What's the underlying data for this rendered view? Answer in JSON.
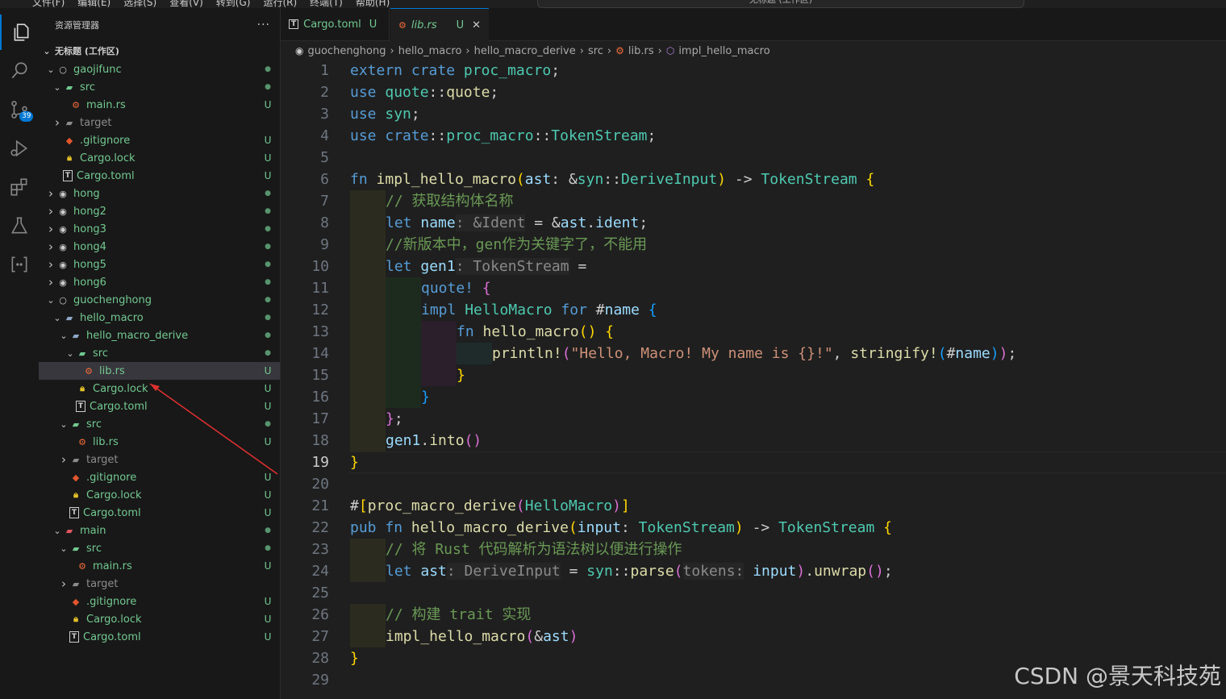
{
  "titlebar": {
    "menu": [
      "文件(F)",
      "编辑(E)",
      "选择(S)",
      "查看(V)",
      "转到(G)",
      "运行(R)",
      "终端(T)",
      "帮助(H)"
    ],
    "command_center": "无标题 (工作区)"
  },
  "activity_bar": {
    "items": [
      "explorer-icon",
      "search-icon",
      "source-control-icon",
      "run-debug-icon",
      "extensions-icon",
      "testing-icon",
      "remote-explorer-icon"
    ],
    "scm_badge": "39"
  },
  "sidebar": {
    "title": "资源管理器",
    "more": "···",
    "workspace_title": "无标题 (工作区)",
    "tree": [
      {
        "depth": 1,
        "chev": "v",
        "icon": "folder-root",
        "label": "gaojifunc",
        "status": "●",
        "color": "green"
      },
      {
        "depth": 2,
        "chev": "v",
        "icon": "folder-src",
        "label": "src",
        "status": "●",
        "color": "green"
      },
      {
        "depth": 3,
        "chev": "",
        "icon": "rust",
        "label": "main.rs",
        "status": "U",
        "color": "green"
      },
      {
        "depth": 2,
        "chev": ">",
        "icon": "folder-target",
        "label": "target",
        "status": "",
        "color": "gray"
      },
      {
        "depth": 2,
        "chev": "",
        "icon": "git",
        "label": ".gitignore",
        "status": "U",
        "color": "green"
      },
      {
        "depth": 2,
        "chev": "",
        "icon": "lock",
        "label": "Cargo.lock",
        "status": "U",
        "color": "green"
      },
      {
        "depth": 2,
        "chev": "",
        "icon": "toml",
        "label": "Cargo.toml",
        "status": "U",
        "color": "green"
      },
      {
        "depth": 1,
        "chev": ">",
        "icon": "folder-root-dot",
        "label": "hong",
        "status": "●",
        "color": "green"
      },
      {
        "depth": 1,
        "chev": ">",
        "icon": "folder-root-dot",
        "label": "hong2",
        "status": "●",
        "color": "green"
      },
      {
        "depth": 1,
        "chev": ">",
        "icon": "folder-root-dot",
        "label": "hong3",
        "status": "●",
        "color": "green"
      },
      {
        "depth": 1,
        "chev": ">",
        "icon": "folder-root-dot",
        "label": "hong4",
        "status": "●",
        "color": "green"
      },
      {
        "depth": 1,
        "chev": ">",
        "icon": "folder-root-dot",
        "label": "hong5",
        "status": "●",
        "color": "green"
      },
      {
        "depth": 1,
        "chev": ">",
        "icon": "folder-root-dot",
        "label": "hong6",
        "status": "●",
        "color": "green"
      },
      {
        "depth": 1,
        "chev": "v",
        "icon": "folder-root",
        "label": "guochenghong",
        "status": "●",
        "color": "green"
      },
      {
        "depth": 2,
        "chev": "v",
        "icon": "folder",
        "label": "hello_macro",
        "status": "●",
        "color": "green"
      },
      {
        "depth": 3,
        "chev": "v",
        "icon": "folder",
        "label": "hello_macro_derive",
        "status": "●",
        "color": "green"
      },
      {
        "depth": 4,
        "chev": "v",
        "icon": "folder-src",
        "label": "src",
        "status": "●",
        "color": "green"
      },
      {
        "depth": 5,
        "chev": "",
        "icon": "rust",
        "label": "lib.rs",
        "status": "U",
        "color": "green",
        "selected": true
      },
      {
        "depth": 4,
        "chev": "",
        "icon": "lock",
        "label": "Cargo.lock",
        "status": "U",
        "color": "green"
      },
      {
        "depth": 4,
        "chev": "",
        "icon": "toml",
        "label": "Cargo.toml",
        "status": "U",
        "color": "green"
      },
      {
        "depth": 3,
        "chev": "v",
        "icon": "folder-src",
        "label": "src",
        "status": "●",
        "color": "green"
      },
      {
        "depth": 4,
        "chev": "",
        "icon": "rust",
        "label": "lib.rs",
        "status": "U",
        "color": "green"
      },
      {
        "depth": 3,
        "chev": ">",
        "icon": "folder-target",
        "label": "target",
        "status": "",
        "color": "gray"
      },
      {
        "depth": 3,
        "chev": "",
        "icon": "git",
        "label": ".gitignore",
        "status": "U",
        "color": "green"
      },
      {
        "depth": 3,
        "chev": "",
        "icon": "lock",
        "label": "Cargo.lock",
        "status": "U",
        "color": "green"
      },
      {
        "depth": 3,
        "chev": "",
        "icon": "toml",
        "label": "Cargo.toml",
        "status": "U",
        "color": "green"
      },
      {
        "depth": 2,
        "chev": "v",
        "icon": "folder-main",
        "label": "main",
        "status": "●",
        "color": "green"
      },
      {
        "depth": 3,
        "chev": "v",
        "icon": "folder-src",
        "label": "src",
        "status": "●",
        "color": "green"
      },
      {
        "depth": 4,
        "chev": "",
        "icon": "rust",
        "label": "main.rs",
        "status": "U",
        "color": "green"
      },
      {
        "depth": 3,
        "chev": ">",
        "icon": "folder-target",
        "label": "target",
        "status": "",
        "color": "gray"
      },
      {
        "depth": 3,
        "chev": "",
        "icon": "git",
        "label": ".gitignore",
        "status": "U",
        "color": "green"
      },
      {
        "depth": 3,
        "chev": "",
        "icon": "lock",
        "label": "Cargo.lock",
        "status": "U",
        "color": "green"
      },
      {
        "depth": 3,
        "chev": "",
        "icon": "toml",
        "label": "Cargo.toml",
        "status": "U",
        "color": "green"
      }
    ]
  },
  "tabs": [
    {
      "label": "Cargo.toml",
      "modified": "U",
      "icon": "toml",
      "active": false
    },
    {
      "label": "lib.rs",
      "modified": "U",
      "icon": "rust",
      "active": true,
      "close": "✕"
    }
  ],
  "breadcrumb": [
    "guochenghong",
    "hello_macro",
    "hello_macro_derive",
    "src",
    "lib.rs",
    "impl_hello_macro"
  ],
  "editor": {
    "current_line": 19,
    "lines": [
      {
        "n": 1,
        "indent": 0,
        "t": [
          [
            "kw",
            "extern "
          ],
          [
            "kw",
            "crate "
          ],
          [
            "ty",
            "proc_macro"
          ],
          [
            "",
            "; "
          ]
        ]
      },
      {
        "n": 2,
        "indent": 0,
        "t": [
          [
            "kw",
            "use "
          ],
          [
            "ty",
            "quote"
          ],
          [
            "",
            "::"
          ],
          [
            "fn",
            "quote"
          ],
          [
            "",
            ";"
          ]
        ]
      },
      {
        "n": 3,
        "indent": 0,
        "t": [
          [
            "kw",
            "use "
          ],
          [
            "ty",
            "syn"
          ],
          [
            "",
            ";"
          ]
        ]
      },
      {
        "n": 4,
        "indent": 0,
        "t": [
          [
            "kw",
            "use "
          ],
          [
            "kw",
            "crate"
          ],
          [
            "",
            "::"
          ],
          [
            "ty",
            "proc_macro"
          ],
          [
            "",
            "::"
          ],
          [
            "ty",
            "TokenStream"
          ],
          [
            "",
            ";"
          ]
        ]
      },
      {
        "n": 5,
        "indent": 0,
        "t": []
      },
      {
        "n": 6,
        "indent": 0,
        "t": [
          [
            "kw",
            "fn "
          ],
          [
            "fn",
            "impl_hello_macro"
          ],
          [
            "p1",
            "("
          ],
          [
            "var",
            "ast"
          ],
          [
            "",
            ": &"
          ],
          [
            "ty",
            "syn"
          ],
          [
            "",
            "::"
          ],
          [
            "ty",
            "DeriveInput"
          ],
          [
            "p1",
            ")"
          ],
          [
            "",
            " -> "
          ],
          [
            "ty",
            "TokenStream "
          ],
          [
            "p1",
            "{"
          ]
        ]
      },
      {
        "n": 7,
        "indent": 1,
        "t": [
          [
            "cm",
            "// 获取结构体名称"
          ]
        ]
      },
      {
        "n": 8,
        "indent": 1,
        "t": [
          [
            "kw",
            "let "
          ],
          [
            "var",
            "name"
          ],
          [
            "hint",
            ": &Ident"
          ],
          [
            "",
            " = &"
          ],
          [
            "var",
            "ast"
          ],
          [
            "",
            "."
          ],
          [
            "var",
            "ident"
          ],
          [
            "",
            ";"
          ]
        ]
      },
      {
        "n": 9,
        "indent": 1,
        "t": [
          [
            "cm",
            "//新版本中，gen作为关键字了，不能用"
          ]
        ]
      },
      {
        "n": 10,
        "indent": 1,
        "t": [
          [
            "kw",
            "let "
          ],
          [
            "var",
            "gen1"
          ],
          [
            "hint",
            ": TokenStream"
          ],
          [
            "",
            " ="
          ]
        ]
      },
      {
        "n": 11,
        "indent": 2,
        "t": [
          [
            "mac",
            "quote! "
          ],
          [
            "p2",
            "{"
          ]
        ]
      },
      {
        "n": 12,
        "indent": 2,
        "t": [
          [
            "kw",
            "impl "
          ],
          [
            "ty",
            "HelloMacro "
          ],
          [
            "kw",
            "for "
          ],
          [
            "",
            "#"
          ],
          [
            "var",
            "name "
          ],
          [
            "p3",
            "{"
          ]
        ]
      },
      {
        "n": 13,
        "indent": 3,
        "t": [
          [
            "kw",
            "fn "
          ],
          [
            "fn",
            "hello_macro"
          ],
          [
            "p1",
            "() {"
          ]
        ]
      },
      {
        "n": 14,
        "indent": 4,
        "t": [
          [
            "fn",
            "println!"
          ],
          [
            "p2",
            "("
          ],
          [
            "str",
            "\"Hello, Macro! My name is {}!\""
          ],
          [
            "",
            ", "
          ],
          [
            "fn",
            "stringify!"
          ],
          [
            "p3",
            "("
          ],
          [
            "",
            "#"
          ],
          [
            "var",
            "name"
          ],
          [
            "p3",
            ")"
          ],
          [
            "p2",
            ")"
          ],
          [
            "",
            ";"
          ]
        ]
      },
      {
        "n": 15,
        "indent": 3,
        "t": [
          [
            "p1",
            "}"
          ]
        ]
      },
      {
        "n": 16,
        "indent": 2,
        "t": [
          [
            "p3",
            "}"
          ]
        ]
      },
      {
        "n": 17,
        "indent": 1,
        "t": [
          [
            "p2",
            "}"
          ],
          [
            "",
            ";"
          ]
        ]
      },
      {
        "n": 18,
        "indent": 1,
        "t": [
          [
            "var",
            "gen1"
          ],
          [
            "",
            "."
          ],
          [
            "fn",
            "into"
          ],
          [
            "p2",
            "()"
          ]
        ]
      },
      {
        "n": 19,
        "indent": 0,
        "t": [
          [
            "p1",
            "}"
          ]
        ]
      },
      {
        "n": 20,
        "indent": 0,
        "t": []
      },
      {
        "n": 21,
        "indent": 0,
        "t": [
          [
            "",
            "#"
          ],
          [
            "p1",
            "["
          ],
          [
            "fn",
            "proc_macro_derive"
          ],
          [
            "p2",
            "("
          ],
          [
            "ty",
            "HelloMacro"
          ],
          [
            "p2",
            ")"
          ],
          [
            "p1",
            "]"
          ]
        ]
      },
      {
        "n": 22,
        "indent": 0,
        "t": [
          [
            "kw",
            "pub "
          ],
          [
            "kw",
            "fn "
          ],
          [
            "fn",
            "hello_macro_derive"
          ],
          [
            "p1",
            "("
          ],
          [
            "var",
            "input"
          ],
          [
            "",
            ": "
          ],
          [
            "ty",
            "TokenStream"
          ],
          [
            "p1",
            ")"
          ],
          [
            "",
            " -> "
          ],
          [
            "ty",
            "TokenStream "
          ],
          [
            "p1",
            "{"
          ]
        ]
      },
      {
        "n": 23,
        "indent": 1,
        "t": [
          [
            "cm",
            "// 将 Rust 代码解析为语法树以便进行操作"
          ]
        ]
      },
      {
        "n": 24,
        "indent": 1,
        "t": [
          [
            "kw",
            "let "
          ],
          [
            "var",
            "ast"
          ],
          [
            "hint",
            ": DeriveInput"
          ],
          [
            "",
            " = "
          ],
          [
            "ty",
            "syn"
          ],
          [
            "",
            "::"
          ],
          [
            "fn",
            "parse"
          ],
          [
            "p2",
            "("
          ],
          [
            "hint",
            "tokens:"
          ],
          [
            "var",
            " input"
          ],
          [
            "p2",
            ")"
          ],
          [
            "",
            "."
          ],
          [
            "fn",
            "unwrap"
          ],
          [
            "p2",
            "()"
          ],
          [
            "",
            ";"
          ]
        ]
      },
      {
        "n": 25,
        "indent": 0,
        "t": []
      },
      {
        "n": 26,
        "indent": 1,
        "t": [
          [
            "cm",
            "// 构建 trait 实现"
          ]
        ]
      },
      {
        "n": 27,
        "indent": 1,
        "t": [
          [
            "fn",
            "impl_hello_macro"
          ],
          [
            "p2",
            "("
          ],
          [
            "",
            "&"
          ],
          [
            "var",
            "ast"
          ],
          [
            "p2",
            ")"
          ]
        ]
      },
      {
        "n": 28,
        "indent": 0,
        "t": [
          [
            "p1",
            "}"
          ]
        ]
      },
      {
        "n": 29,
        "indent": 0,
        "t": []
      }
    ]
  },
  "watermark": "CSDN @景天科技苑",
  "colors": {
    "accent": "#0078d4",
    "git_untracked": "#73c991",
    "annotation_arrow": "#e03030"
  }
}
